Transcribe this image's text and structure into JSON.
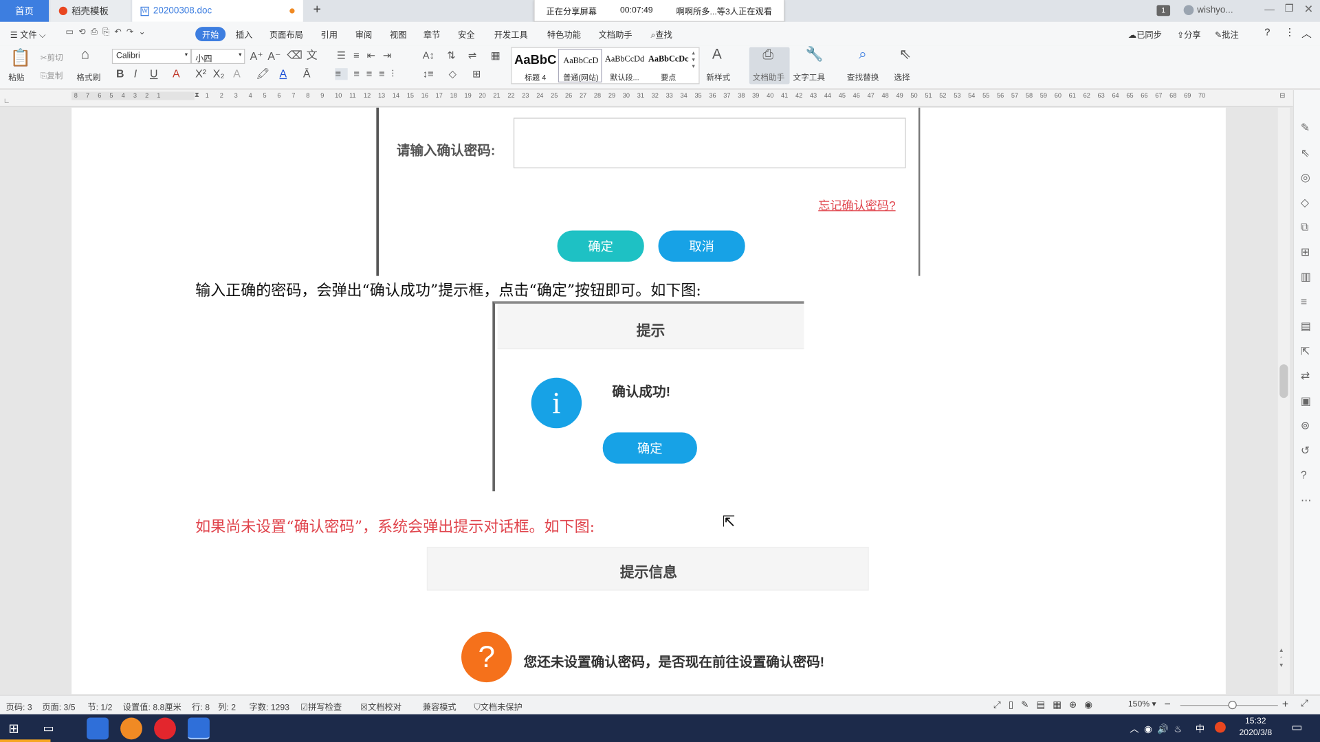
{
  "tabs": {
    "home": "首页",
    "template": "稻壳模板",
    "doc": "20200308.doc",
    "new": "+"
  },
  "share_bar": {
    "status": "正在分享屏幕",
    "time": "00:07:49",
    "viewers": "啊啊所多...等3人正在观看"
  },
  "window": {
    "badge": "1",
    "user": "wishyo..."
  },
  "menu": {
    "file": "文件",
    "start": "开始",
    "insert": "插入",
    "layout": "页面布局",
    "reference": "引用",
    "review": "审阅",
    "view": "视图",
    "chapter": "章节",
    "security": "安全",
    "dev": "开发工具",
    "special": "特色功能",
    "assistant": "文档助手",
    "search": "查找",
    "synced": "已同步",
    "share": "分享",
    "comment": "批注"
  },
  "ribbon": {
    "paste": "粘贴",
    "cut": "剪切",
    "copy": "复制",
    "format_painter": "格式刷",
    "font": "Calibri",
    "size": "小四",
    "styles": [
      {
        "preview": "AaBbC",
        "name": "标题 4"
      },
      {
        "preview": "AaBbCcD",
        "name": "普通(网站)"
      },
      {
        "preview": "AaBbCcDd",
        "name": "默认段..."
      },
      {
        "preview": "AaBbCcDc",
        "name": "要点"
      }
    ],
    "new_style": "新样式",
    "doc_assistant": "文档助手",
    "text_tools": "文字工具",
    "find_replace": "查找替换",
    "select": "选择"
  },
  "ruler": {
    "left_ticks": [
      "8",
      "7",
      "6",
      "5",
      "4",
      "3",
      "2",
      "1"
    ],
    "right_ticks": [
      "1",
      "2",
      "3",
      "4",
      "5",
      "6",
      "7",
      "8",
      "9",
      "10",
      "11",
      "12",
      "13",
      "14",
      "15",
      "16",
      "17",
      "18",
      "19",
      "20",
      "21",
      "22",
      "23",
      "24",
      "25",
      "26",
      "27",
      "28",
      "29",
      "30",
      "31",
      "32",
      "33",
      "34",
      "35",
      "36",
      "37",
      "38",
      "39",
      "40",
      "41",
      "42",
      "43",
      "44",
      "45",
      "46",
      "47",
      "48",
      "49",
      "50",
      "51",
      "52",
      "53",
      "54",
      "55",
      "56",
      "57",
      "58",
      "59",
      "60",
      "61",
      "62",
      "63",
      "64",
      "65",
      "66",
      "67",
      "68",
      "69",
      "70"
    ]
  },
  "doc": {
    "dialog1": {
      "label": "请输入确认密码:",
      "forgot": "忘记确认密码?",
      "ok": "确定",
      "cancel": "取消"
    },
    "para1": "输入正确的密码，会弹出“确认成功”提示框，点击“确定”按钮即可。如下图:",
    "dialog2": {
      "title": "提示",
      "message": "确认成功!",
      "ok": "确定",
      "icon": "i"
    },
    "para2": "如果尚未设置“确认密码”，系统会弹出提示对话框。如下图:",
    "dialog3": {
      "title": "提示信息",
      "message": "您还未设置确认密码，是否现在前往设置确认密码!",
      "icon": "?"
    }
  },
  "status": {
    "page_num": "页码: 3",
    "page": "页面: 3/5",
    "section": "节: 1/2",
    "setting": "设置值: 8.8厘米",
    "row": "行: 8",
    "col": "列: 2",
    "words": "字数: 1293",
    "spell": "拼写检查",
    "proof": "文档校对",
    "compat": "兼容模式",
    "protect": "文档未保护",
    "zoom": "150%"
  },
  "taskbar": {
    "ime": "中",
    "time": "15:32",
    "date": "2020/3/8"
  },
  "colors": {
    "accent": "#3d7ee0",
    "red_text": "#e0454d",
    "teal": "#1ec1c4",
    "blue_btn": "#17a2e6",
    "orange_icon": "#f5711b"
  }
}
